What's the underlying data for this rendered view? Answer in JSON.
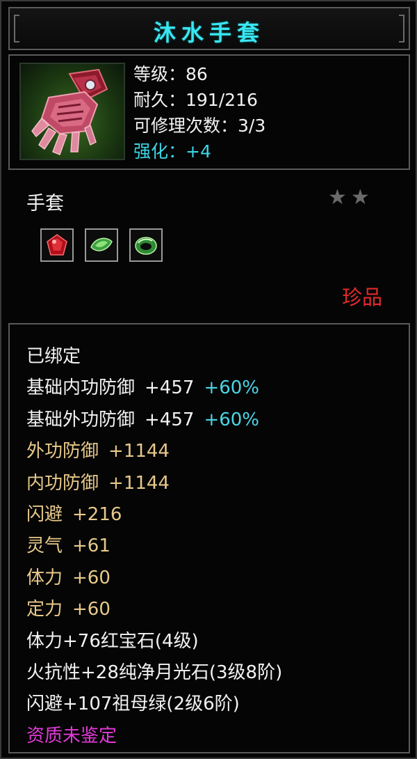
{
  "title": "沐水手套",
  "header": {
    "level": "等级：86",
    "durability": "耐久：191/216",
    "repairs": "可修理次数：3/3",
    "enhance": "强化：+4"
  },
  "item_type": "手套",
  "stars_count": 2,
  "gem_slots": [
    "red-ruby-icon",
    "green-crystal-icon",
    "green-jade-ring-icon"
  ],
  "rarity": "珍品",
  "attributes": {
    "bound": "已绑定",
    "base_inner_def": {
      "label": "基础内功防御",
      "value": "+457",
      "pct": "+60%"
    },
    "base_outer_def": {
      "label": "基础外功防御",
      "value": "+457",
      "pct": "+60%"
    },
    "outer_def": {
      "label": "外功防御",
      "value": "+1144"
    },
    "inner_def": {
      "label": "内功防御",
      "value": "+1144"
    },
    "dodge": {
      "label": "闪避",
      "value": "+216"
    },
    "spirit": {
      "label": "灵气",
      "value": "+61"
    },
    "stamina": {
      "label": "体力",
      "value": "+60"
    },
    "focus": {
      "label": "定力",
      "value": "+60"
    },
    "gem1": "体力+76红宝石(4级)",
    "gem2": "火抗性+28纯净月光石(3级8阶)",
    "gem3": "闪避+107祖母绿(2级6阶)",
    "aptitude": "资质未鉴定"
  },
  "colors": {
    "title": "#39e6f0",
    "cyan": "#3cd6e6",
    "gold": "#e7c98a",
    "rarity": "#e22a2a",
    "aptitude": "#e23ad8"
  }
}
